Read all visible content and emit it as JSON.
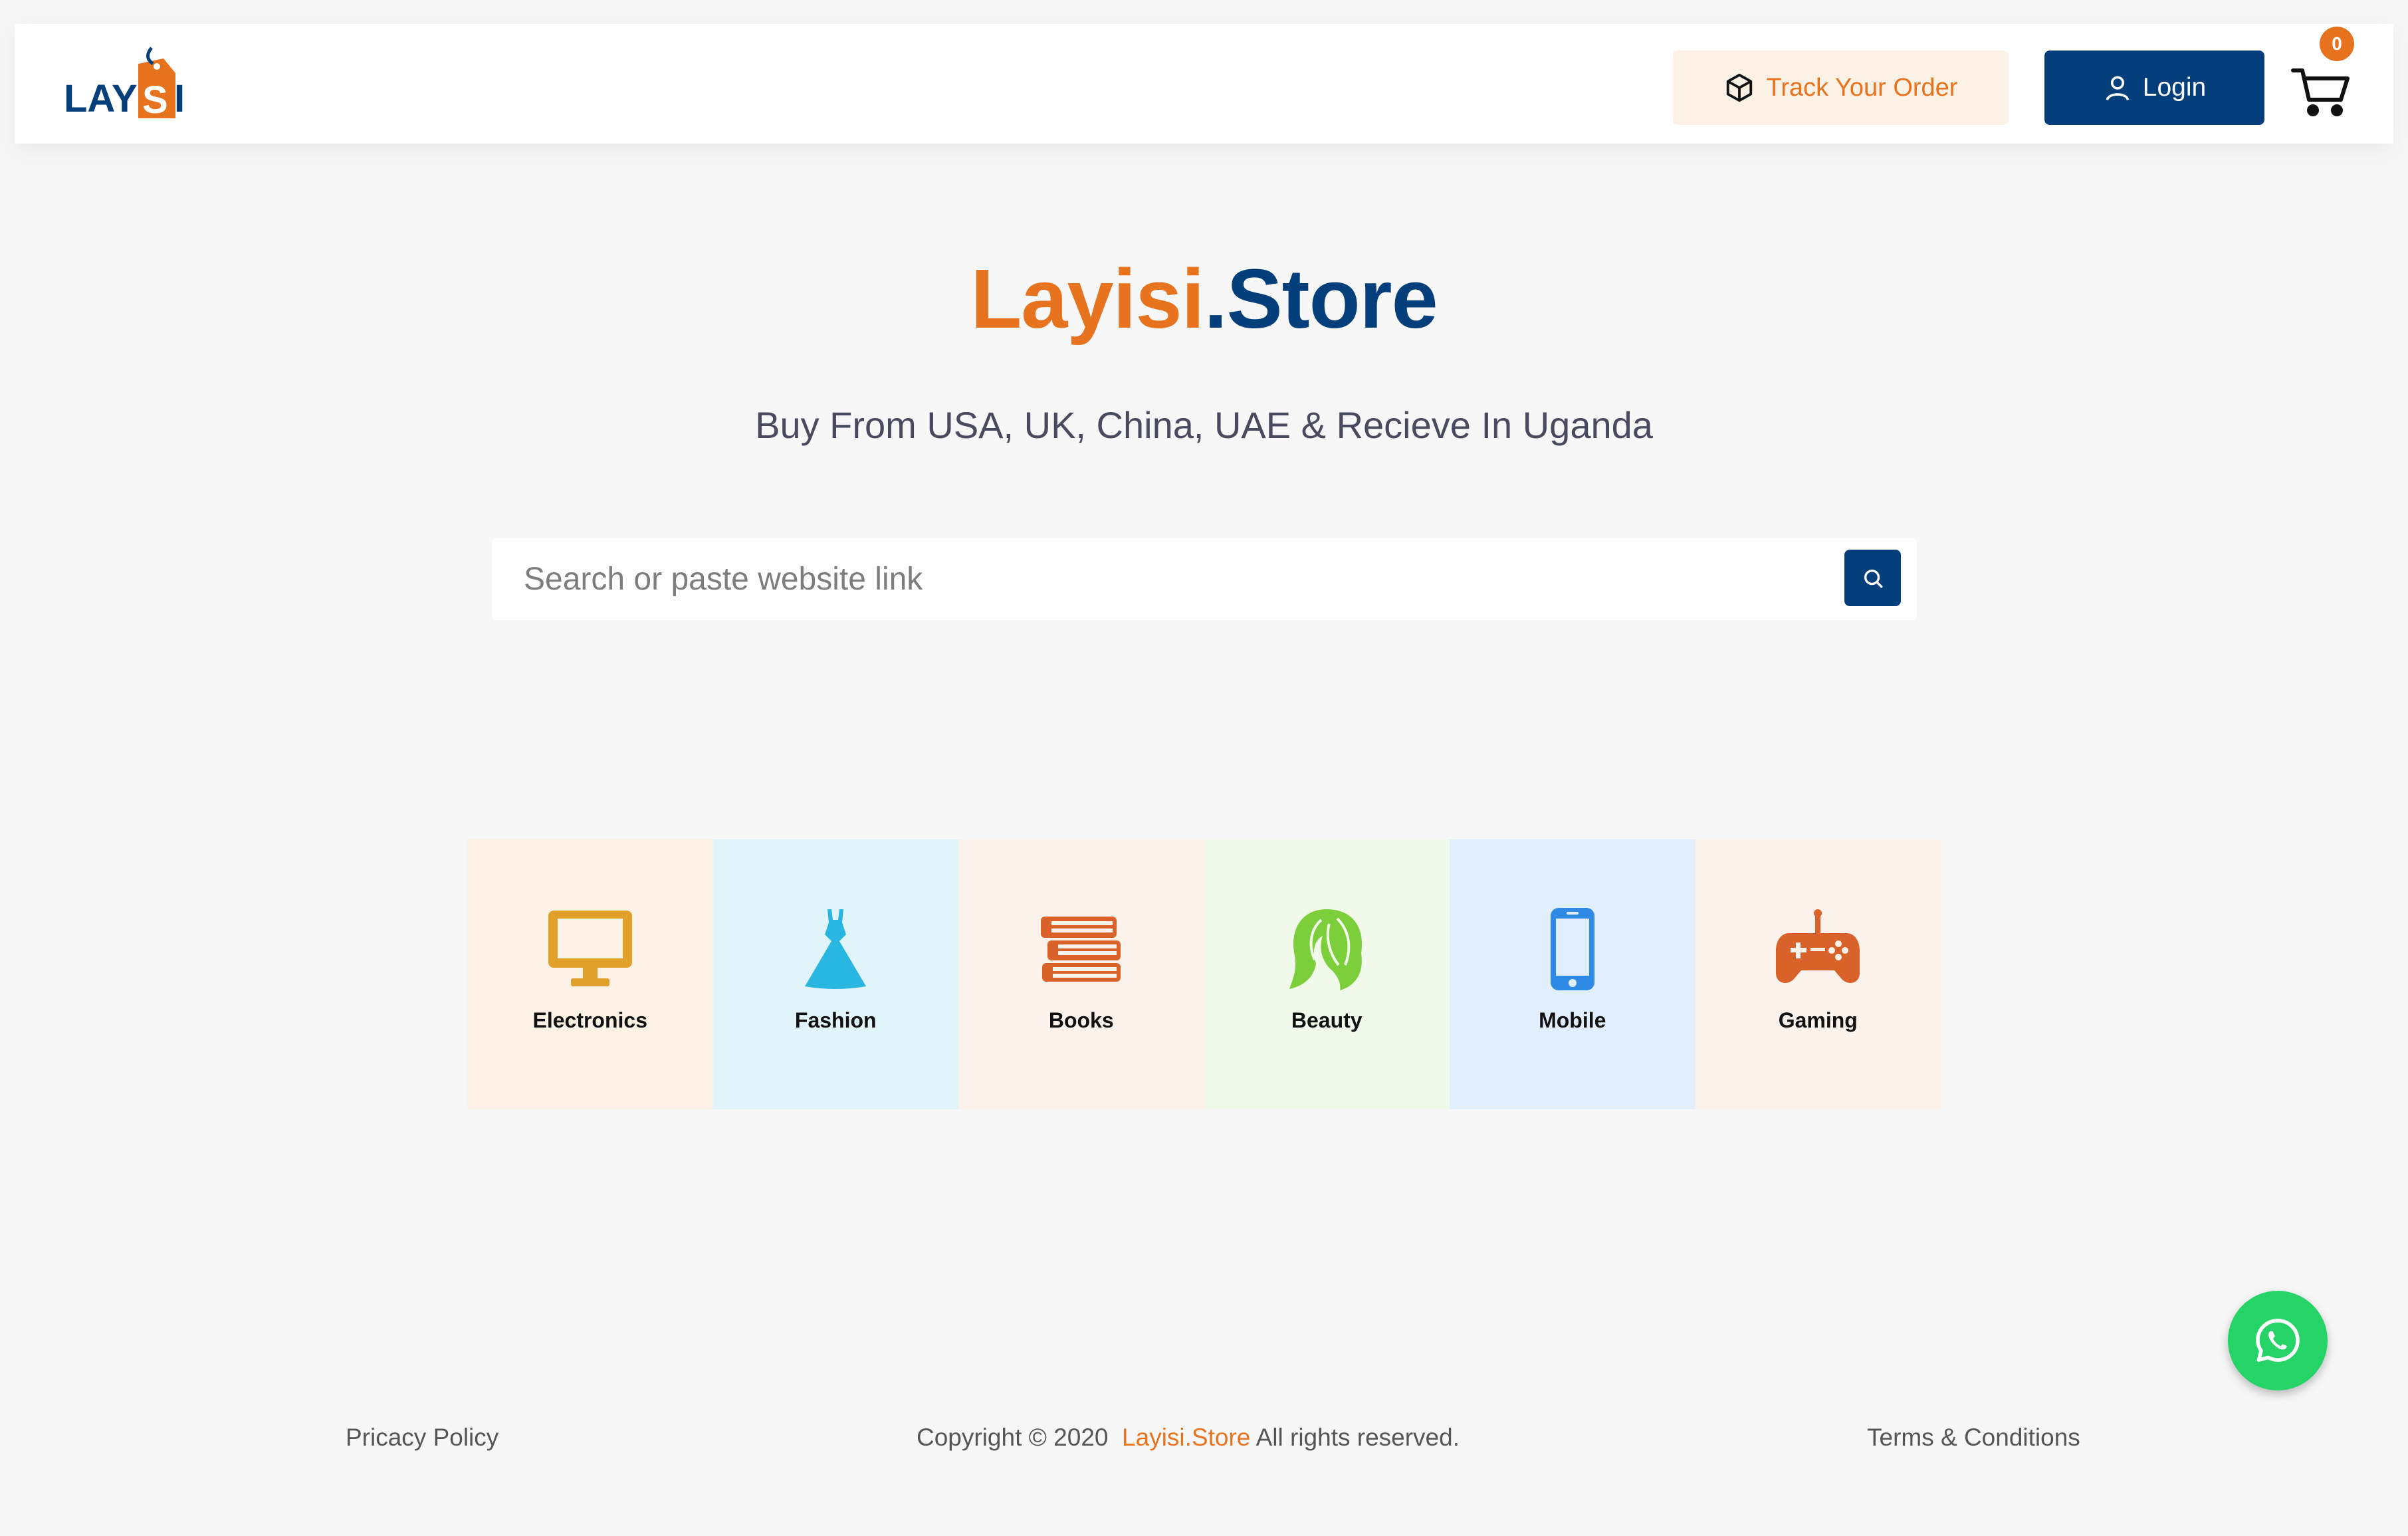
{
  "header": {
    "logo_text": "LAYISI",
    "track_label": "Track Your Order",
    "login_label": "Login",
    "cart_count": "0"
  },
  "hero": {
    "brand": "Layisi",
    "suffix": ".Store",
    "tagline": "Buy From USA, UK, China, UAE & Recieve In Uganda"
  },
  "search": {
    "placeholder": "Search or paste website link",
    "value": ""
  },
  "categories": [
    {
      "label": "Electronics",
      "icon": "monitor-icon",
      "bg": "#fbf1e4",
      "color": "#e1a02a"
    },
    {
      "label": "Fashion",
      "icon": "dress-icon",
      "bg": "#e1f4fa",
      "color": "#29b6e0"
    },
    {
      "label": "Books",
      "icon": "books-icon",
      "bg": "#fcf2ec",
      "color": "#d9622a"
    },
    {
      "label": "Beauty",
      "icon": "hair-icon",
      "bg": "#f1faea",
      "color": "#7ccf3a"
    },
    {
      "label": "Mobile",
      "icon": "smartphone-icon",
      "bg": "#e1eefc",
      "color": "#2f8ae6"
    },
    {
      "label": "Gaming",
      "icon": "gamepad-icon",
      "bg": "#fcf2ec",
      "color": "#d9622a"
    }
  ],
  "footer": {
    "privacy": "Pricacy Policy",
    "copyright_prefix": "Copyright © 2020  ",
    "copyright_brand": "Layisi.Store",
    "copyright_suffix": " All rights reserved.",
    "terms": "Terms & Conditions"
  },
  "colors": {
    "brand_orange": "#e8731f",
    "brand_navy": "#043f7c",
    "whatsapp_green": "#25d366"
  }
}
